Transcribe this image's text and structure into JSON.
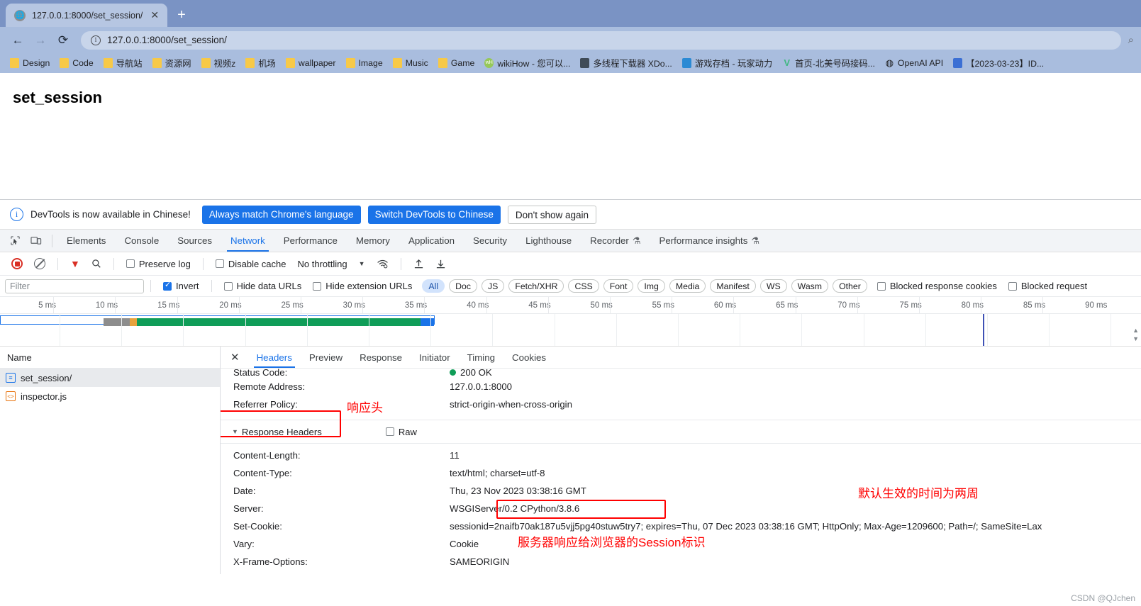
{
  "browser": {
    "tab": {
      "title": "127.0.0.1:8000/set_session/",
      "favicon": "globe-icon",
      "close": "✕"
    },
    "new_tab": "+",
    "nav": {
      "back": "←",
      "forward": "→",
      "reload": "⟳"
    },
    "omnibox": {
      "value": "127.0.0.1:8000/set_session/",
      "info_icon": "ⓘ",
      "right_icon": "search-icon"
    },
    "bookmarks": [
      {
        "label": "Design",
        "icon": "folder-icon"
      },
      {
        "label": "Code",
        "icon": "folder-icon"
      },
      {
        "label": "导航站",
        "icon": "folder-icon"
      },
      {
        "label": "资源网",
        "icon": "folder-icon"
      },
      {
        "label": "视频z",
        "icon": "folder-icon"
      },
      {
        "label": "机场",
        "icon": "folder-icon"
      },
      {
        "label": "wallpaper",
        "icon": "folder-icon"
      },
      {
        "label": "Image",
        "icon": "folder-icon"
      },
      {
        "label": "Music",
        "icon": "folder-icon"
      },
      {
        "label": "Game",
        "icon": "folder-icon"
      },
      {
        "label": "wikiHow - 您可以...",
        "icon": "wikihow-icon"
      },
      {
        "label": "多线程下载器 XDo...",
        "icon": "xdown-icon"
      },
      {
        "label": "游戏存档 - 玩家动力",
        "icon": "game-icon"
      },
      {
        "label": "首页-北美号码接码...",
        "icon": "vue-icon"
      },
      {
        "label": "OpenAI API",
        "icon": "openai-icon"
      },
      {
        "label": "【2023-03-23】ID...",
        "icon": "blue-icon"
      }
    ]
  },
  "page": {
    "heading": "set_session"
  },
  "devtools": {
    "banner": {
      "message": "DevTools is now available in Chinese!",
      "info_icon": "info-icon",
      "btn_always": "Always match Chrome's language",
      "btn_switch": "Switch DevTools to Chinese",
      "btn_dismiss": "Don't show again"
    },
    "tabs": [
      {
        "label": "Elements",
        "active": false
      },
      {
        "label": "Console",
        "active": false
      },
      {
        "label": "Sources",
        "active": false
      },
      {
        "label": "Network",
        "active": true
      },
      {
        "label": "Performance",
        "active": false
      },
      {
        "label": "Memory",
        "active": false
      },
      {
        "label": "Application",
        "active": false
      },
      {
        "label": "Security",
        "active": false
      },
      {
        "label": "Lighthouse",
        "active": false
      },
      {
        "label": "Recorder",
        "active": false,
        "flask": "⚗"
      },
      {
        "label": "Performance insights",
        "active": false,
        "flask": "⚗"
      }
    ],
    "toolbar": {
      "record_icon": "record-icon",
      "clear_icon": "clear-icon",
      "filter_icon": "funnel-icon",
      "search_icon": "search-icon",
      "preserve_log": {
        "label": "Preserve log",
        "checked": false
      },
      "disable_cache": {
        "label": "Disable cache",
        "checked": false
      },
      "throttling": {
        "value": "No throttling",
        "caret": "▼"
      },
      "wifi_icon": "wifi-settings-icon",
      "import_icon": "import-har-icon",
      "export_icon": "export-har-icon"
    },
    "filterbar": {
      "filter_placeholder": "Filter",
      "filter_value": "",
      "invert": {
        "label": "Invert",
        "checked": true
      },
      "hide_data_urls": {
        "label": "Hide data URLs",
        "checked": false
      },
      "hide_extension_urls": {
        "label": "Hide extension URLs",
        "checked": false
      },
      "types": [
        "All",
        "Doc",
        "JS",
        "Fetch/XHR",
        "CSS",
        "Font",
        "Img",
        "Media",
        "Manifest",
        "WS",
        "Wasm",
        "Other"
      ],
      "active_type": "All",
      "blocked_response_cookies": {
        "label": "Blocked response cookies",
        "checked": false
      },
      "blocked_requests": {
        "label": "Blocked request",
        "checked": false
      }
    },
    "overview": {
      "ticks": [
        "5 ms",
        "10 ms",
        "15 ms",
        "20 ms",
        "25 ms",
        "30 ms",
        "35 ms",
        "40 ms",
        "45 ms",
        "50 ms",
        "55 ms",
        "60 ms",
        "65 ms",
        "70 ms",
        "75 ms",
        "80 ms",
        "85 ms",
        "90 ms"
      ],
      "colors": {
        "waiting": "#8d8d8d",
        "stalled": "#e8a33d",
        "download": "#0f9d58",
        "total": "#1a73e8"
      }
    },
    "requests": {
      "column_header": "Name",
      "rows": [
        {
          "name": "set_session/",
          "icon": "document-icon",
          "selected": true
        },
        {
          "name": "inspector.js",
          "icon": "script-icon",
          "selected": false
        }
      ]
    },
    "detail": {
      "close": "✕",
      "tabs": [
        {
          "label": "Headers",
          "active": true
        },
        {
          "label": "Preview",
          "active": false
        },
        {
          "label": "Response",
          "active": false
        },
        {
          "label": "Initiator",
          "active": false
        },
        {
          "label": "Timing",
          "active": false
        },
        {
          "label": "Cookies",
          "active": false
        }
      ],
      "general_rows": [
        {
          "key": "Status Code:",
          "value": "200 OK",
          "dot": true
        },
        {
          "key": "Remote Address:",
          "value": "127.0.0.1:8000"
        },
        {
          "key": "Referrer Policy:",
          "value": "strict-origin-when-cross-origin"
        }
      ],
      "section": {
        "title": "Response Headers",
        "triangle": "▼",
        "raw_label": "Raw",
        "raw_checked": false
      },
      "response_headers": [
        {
          "key": "Content-Length:",
          "value": "11"
        },
        {
          "key": "Content-Type:",
          "value": "text/html; charset=utf-8"
        },
        {
          "key": "Date:",
          "value": "Thu, 23 Nov 2023 03:38:16 GMT"
        },
        {
          "key": "Server:",
          "value": "WSGIServer/0.2 CPython/3.8.6"
        },
        {
          "key": "Set-Cookie:",
          "value": "",
          "parts": {
            "prefix": "sessionid=",
            "highlight": "2naifb70ak187u5vjj5pg40stuw5try7;",
            "suffix": " expires=Thu, 07 Dec 2023 03:38:16 GMT; HttpOnly; Max-Age=1209600; Path=/; SameSite=Lax"
          }
        },
        {
          "key": "Vary:",
          "value": "Cookie"
        },
        {
          "key": "X-Frame-Options:",
          "value": "SAMEORIGIN"
        }
      ]
    }
  },
  "annotations": {
    "response_headers_label": "响应头",
    "expires_label": "默认生效的时间为两周",
    "session_label": "服务器响应给浏览器的Session标识"
  },
  "watermark": "CSDN @QJchen"
}
